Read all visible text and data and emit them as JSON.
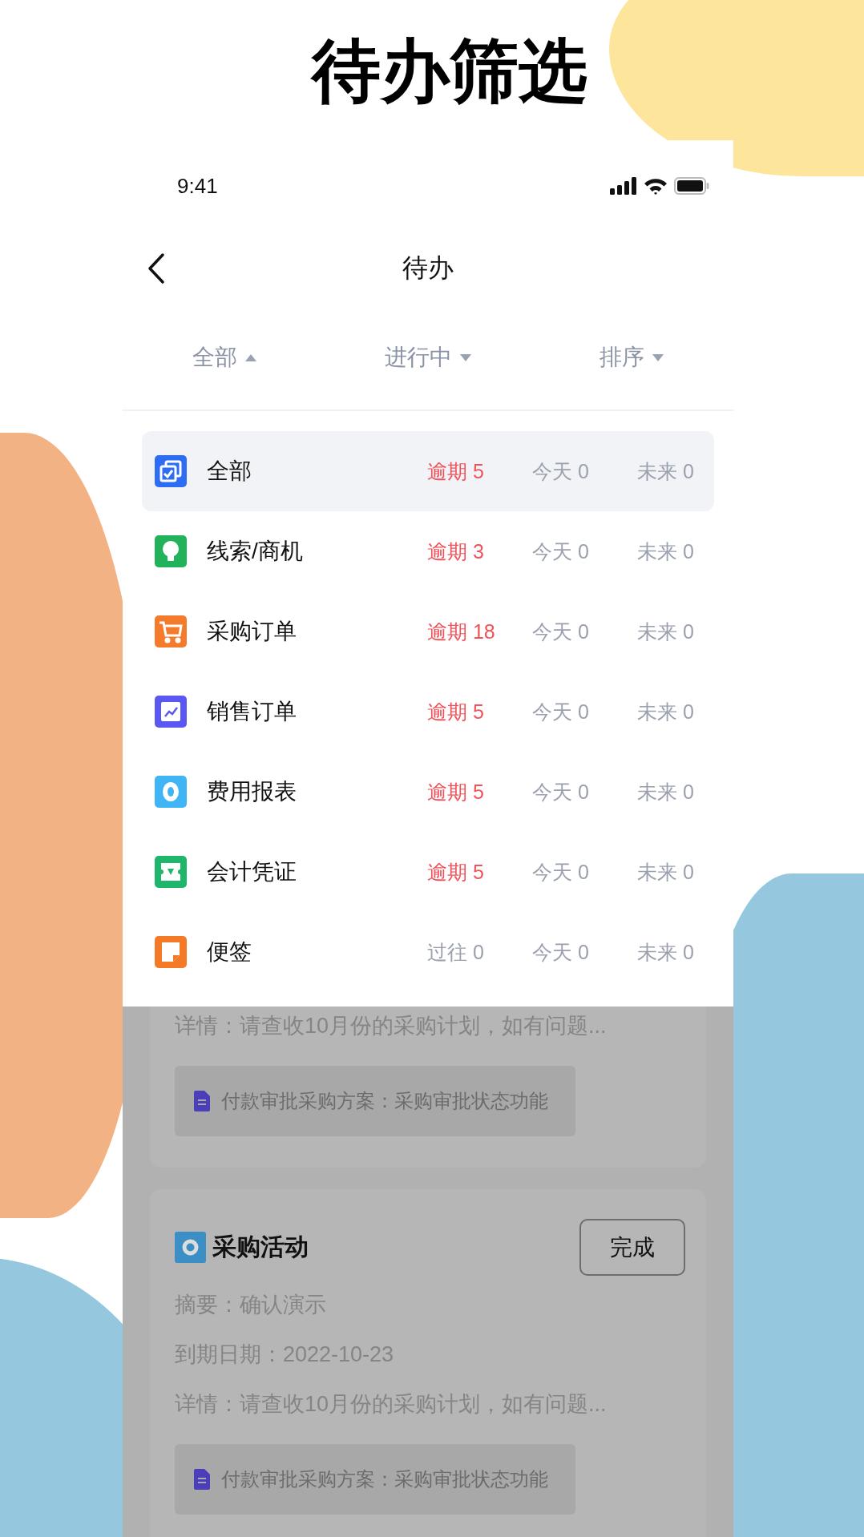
{
  "headline": "待办筛选",
  "status_bar": {
    "time": "9:41"
  },
  "nav": {
    "title": "待办"
  },
  "filters": [
    {
      "label": "全部",
      "expanded": true
    },
    {
      "label": "进行中",
      "expanded": false
    },
    {
      "label": "排序",
      "expanded": false
    }
  ],
  "categories": [
    {
      "name": "全部",
      "kind": "all",
      "color": "#2f6cf4",
      "selected": true,
      "counts": [
        {
          "text": "逾期 5",
          "overdue": true
        },
        {
          "text": "今天 0",
          "overdue": false
        },
        {
          "text": "未来 0",
          "overdue": false
        }
      ]
    },
    {
      "name": "线索/商机",
      "kind": "bulb",
      "color": "#22b25c",
      "selected": false,
      "counts": [
        {
          "text": "逾期 3",
          "overdue": true
        },
        {
          "text": "今天 0",
          "overdue": false
        },
        {
          "text": "未来 0",
          "overdue": false
        }
      ]
    },
    {
      "name": "采购订单",
      "kind": "cart",
      "color": "#f57b2c",
      "selected": false,
      "counts": [
        {
          "text": "逾期 18",
          "overdue": true
        },
        {
          "text": "今天 0",
          "overdue": false
        },
        {
          "text": "未来 0",
          "overdue": false
        }
      ]
    },
    {
      "name": "销售订单",
      "kind": "chart",
      "color": "#5b57f2",
      "selected": false,
      "counts": [
        {
          "text": "逾期 5",
          "overdue": true
        },
        {
          "text": "今天 0",
          "overdue": false
        },
        {
          "text": "未来 0",
          "overdue": false
        }
      ]
    },
    {
      "name": "费用报表",
      "kind": "coin",
      "color": "#3fb5f6",
      "selected": false,
      "counts": [
        {
          "text": "逾期 5",
          "overdue": true
        },
        {
          "text": "今天 0",
          "overdue": false
        },
        {
          "text": "未来 0",
          "overdue": false
        }
      ]
    },
    {
      "name": "会计凭证",
      "kind": "ticket",
      "color": "#1fb56b",
      "selected": false,
      "counts": [
        {
          "text": "逾期 5",
          "overdue": true
        },
        {
          "text": "今天 0",
          "overdue": false
        },
        {
          "text": "未来 0",
          "overdue": false
        }
      ]
    },
    {
      "name": "便签",
      "kind": "note",
      "color": "#f57a27",
      "selected": false,
      "counts": [
        {
          "text": "过往 0",
          "overdue": false
        },
        {
          "text": "今天 0",
          "overdue": false
        },
        {
          "text": "未来 0",
          "overdue": false
        }
      ]
    }
  ],
  "cards": [
    {
      "detail": "详情：请查收10月份的采购计划，如有问题...",
      "attachment": "付款审批采购方案：采购审批状态功能"
    },
    {
      "title": "采购活动",
      "button": "完成",
      "summary": "摘要：确认演示",
      "due": "到期日期：2022-10-23",
      "detail": "详情：请查收10月份的采购计划，如有问题...",
      "attachment": "付款审批采购方案：采购审批状态功能"
    }
  ]
}
